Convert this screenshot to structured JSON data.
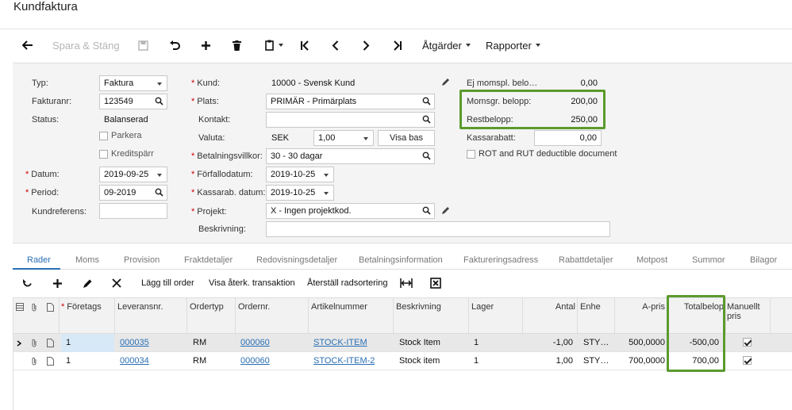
{
  "page": {
    "title": "Kundfaktura"
  },
  "toolbar": {
    "save_close": "Spara & Stäng",
    "actions": "Åtgärder",
    "reports": "Rapporter"
  },
  "form": {
    "type_label": "Typ:",
    "type_value": "Faktura",
    "invoice_nr_label": "Fakturanr:",
    "invoice_nr_value": "123549",
    "status_label": "Status:",
    "status_value": "Balanserad",
    "hold_label": "Parkera",
    "credit_hold_label": "Kreditspärr",
    "date_label": "Datum:",
    "date_value": "2019-09-25",
    "period_label": "Period:",
    "period_value": "09-2019",
    "customer_ref_label": "Kundreferens:",
    "customer_ref_value": "",
    "customer_label": "Kund:",
    "customer_value": "10000 - Svensk Kund",
    "location_label": "Plats:",
    "location_value": "PRIMÄR - Primärplats",
    "contact_label": "Kontakt:",
    "contact_value": "",
    "currency_label": "Valuta:",
    "currency_value": "SEK",
    "rate_value": "1,00",
    "view_base_label": "Visa bas",
    "terms_label": "Betalningsvillkor:",
    "terms_value": "30 - 30 dagar",
    "due_date_label": "Förfallodatum:",
    "due_date_value": "2019-10-25",
    "discount_date_label": "Kassarab. datum:",
    "discount_date_value": "2019-10-25",
    "project_label": "Projekt:",
    "project_value": "X - Ingen projektkod.",
    "description_label": "Beskrivning:",
    "description_value": "",
    "non_taxable_label": "Ej momspl. belo…",
    "non_taxable_value": "0,00",
    "taxable_label": "Momsgr. belopp:",
    "taxable_value": "200,00",
    "balance_label": "Restbelopp:",
    "balance_value": "250,00",
    "cash_discount_label": "Kassarabatt:",
    "cash_discount_value": "0,00",
    "rot_rut_label": "ROT and RUT deductible document"
  },
  "tabs": [
    "Rader",
    "Moms",
    "Provision",
    "Fraktdetaljer",
    "Redovisningsdetaljer",
    "Betalningsinformation",
    "Faktureringsadress",
    "Rabattdetaljer",
    "Motpost",
    "Summor",
    "Bilagor"
  ],
  "grid_toolbar": {
    "add_order": "Lägg till order",
    "view_reversing": "Visa återk. transaktion",
    "reset_sort": "Återställ radsortering"
  },
  "grid": {
    "columns": [
      "Företags",
      "Leveransnr.",
      "Ordertyp",
      "Ordernr.",
      "Artikelnummer",
      "Beskrivning",
      "Lager",
      "Antal",
      "Enhe",
      "A-pris",
      "Totalbelop",
      "Manuellt pris"
    ],
    "rows": [
      {
        "branch": "1",
        "shipment": "000035",
        "order_type": "RM",
        "order_nr": "000060",
        "item": "STOCK-ITEM",
        "description": "Stock Item",
        "warehouse": "1",
        "qty": "-1,00",
        "uom": "STY…",
        "unit_price": "500,0000",
        "total": "-500,00"
      },
      {
        "branch": "1",
        "shipment": "000034",
        "order_type": "RM",
        "order_nr": "000060",
        "item": "STOCK-ITEM-2",
        "description": "Stock item",
        "warehouse": "1",
        "qty": "1,00",
        "uom": "STY…",
        "unit_price": "700,0000",
        "total": "700,00"
      }
    ]
  },
  "colors": {
    "accent": "#2a6fb5",
    "highlight": "#5b9a2c",
    "required": "#c00000"
  }
}
